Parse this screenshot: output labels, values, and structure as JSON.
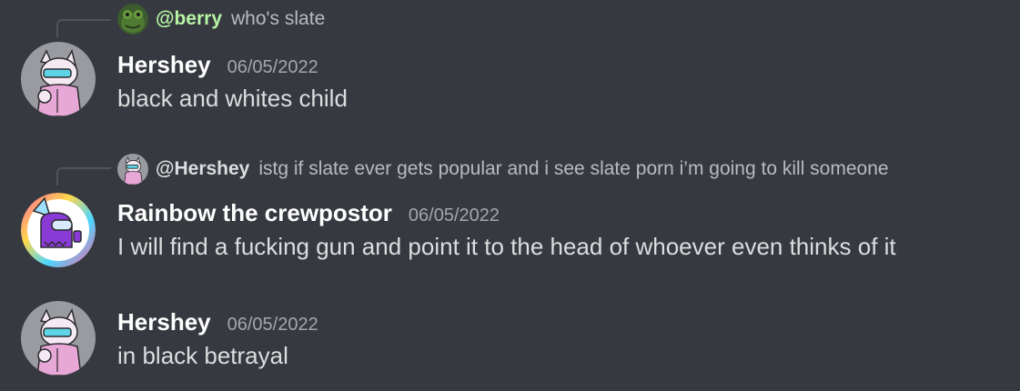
{
  "colors": {
    "background": "#36393f",
    "reply_line": "#4f545c",
    "berry_name": "#b6f5a4",
    "hershey_mention": "#dcddde",
    "username": "#ffffff",
    "timestamp": "#a3a6aa",
    "message_text": "#dcddde"
  },
  "messages": [
    {
      "reply": {
        "avatar_icon": "green-frog-avatar-icon",
        "mention": "@berry",
        "text": "who's slate"
      },
      "avatar_icon": "pink-cat-character-avatar-icon",
      "username": "Hershey",
      "timestamp": "06/05/2022",
      "content": "black and whites child"
    },
    {
      "reply": {
        "avatar_icon": "pink-cat-character-avatar-icon",
        "mention": "@Hershey",
        "text": "istg if slate ever gets popular and i see slate porn i’m going to kill someone"
      },
      "avatar_icon": "purple-crewmate-rainbow-avatar-icon",
      "username": "Rainbow the crewpostor",
      "timestamp": "06/05/2022",
      "content": "I will find a fucking gun and point it to the head of whoever even thinks of it"
    },
    {
      "avatar_icon": "pink-cat-character-avatar-icon",
      "username": "Hershey",
      "timestamp": "06/05/2022",
      "content": "in black betrayal"
    }
  ]
}
